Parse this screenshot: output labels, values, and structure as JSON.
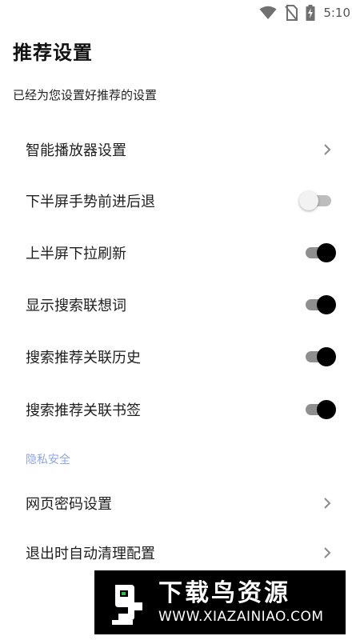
{
  "status_bar": {
    "time": "5:10",
    "icons": [
      "wifi-icon",
      "no-sim-icon",
      "battery-charging-icon"
    ]
  },
  "header": {
    "title": "推荐设置",
    "subtitle": "已经为您设置好推荐的设置"
  },
  "settings": {
    "items": [
      {
        "label": "智能播放器设置",
        "control": "chevron"
      },
      {
        "label": "下半屏手势前进后退",
        "control": "toggle",
        "enabled": false
      },
      {
        "label": "上半屏下拉刷新",
        "control": "toggle",
        "enabled": true
      },
      {
        "label": "显示搜索联想词",
        "control": "toggle",
        "enabled": true
      },
      {
        "label": "搜索推荐关联历史",
        "control": "toggle",
        "enabled": true
      },
      {
        "label": "搜索推荐关联书签",
        "control": "toggle",
        "enabled": true
      }
    ]
  },
  "privacy": {
    "section_title": "隐私安全",
    "items": [
      {
        "label": "网页密码设置",
        "control": "chevron"
      },
      {
        "label": "退出时自动清理配置",
        "control": "chevron"
      }
    ]
  },
  "watermark": {
    "title": "下载鸟资源",
    "url": "WWW.XIAZAINIAO.COM"
  },
  "colors": {
    "section_accent": "#8fa6e8",
    "toggle_on_thumb": "#000000",
    "toggle_on_track": "#8f8f8f",
    "toggle_off_track": "#bdbdbd"
  }
}
